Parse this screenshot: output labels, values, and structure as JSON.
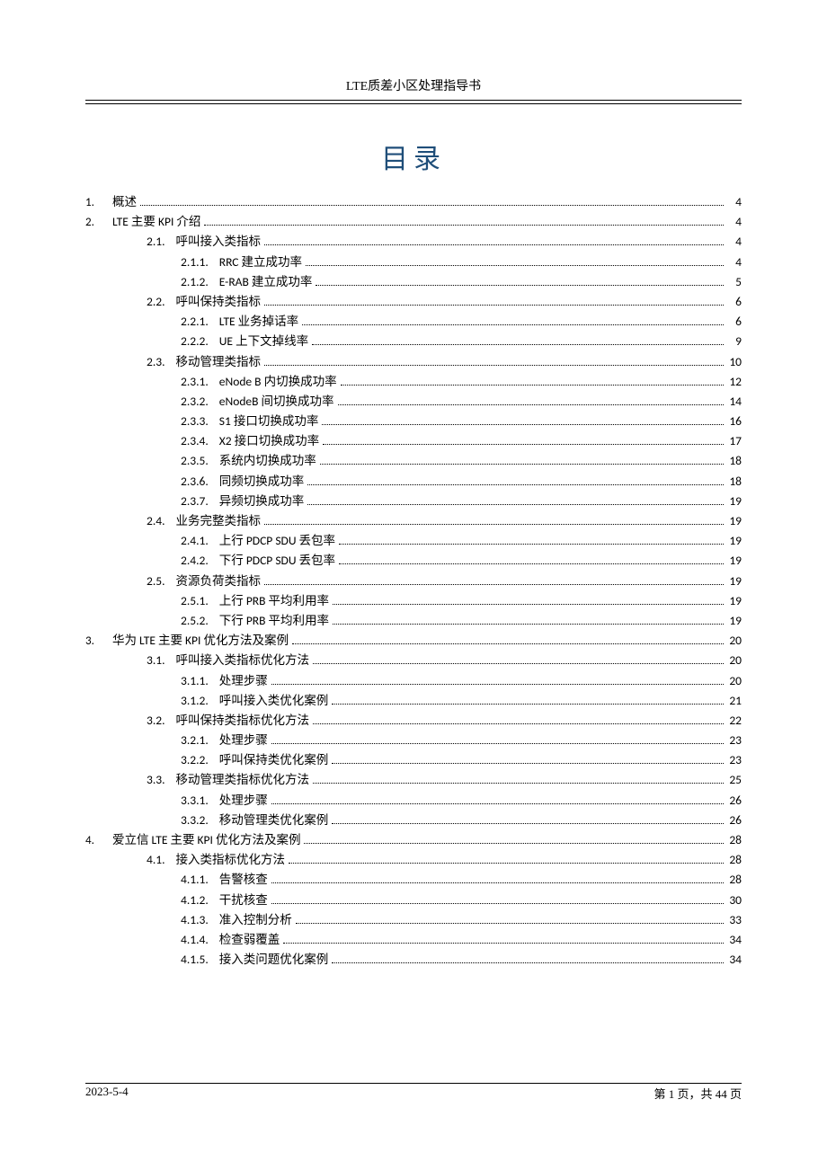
{
  "header": {
    "title": "LTE质差小区处理指导书"
  },
  "toc_title": "目录",
  "entries": [
    {
      "lv": 1,
      "chap": "1.",
      "num": "",
      "text": "概述",
      "page": "4"
    },
    {
      "lv": 1,
      "chap": "2.",
      "num": "",
      "text": "LTE 主要 KPI 介绍",
      "page": "4"
    },
    {
      "lv": 2,
      "chap": "",
      "num": "2.1.",
      "text": "呼叫接入类指标",
      "page": "4"
    },
    {
      "lv": 3,
      "chap": "",
      "num": "2.1.1.",
      "text": "RRC 建立成功率",
      "page": "4"
    },
    {
      "lv": 3,
      "chap": "",
      "num": "2.1.2.",
      "text": "E-RAB 建立成功率",
      "page": "5"
    },
    {
      "lv": 2,
      "chap": "",
      "num": "2.2.",
      "text": "呼叫保持类指标",
      "page": "6"
    },
    {
      "lv": 3,
      "chap": "",
      "num": "2.2.1.",
      "text": "LTE 业务掉话率",
      "page": "6"
    },
    {
      "lv": 3,
      "chap": "",
      "num": "2.2.2.",
      "text": "UE 上下文掉线率",
      "page": "9"
    },
    {
      "lv": 2,
      "chap": "",
      "num": "2.3.",
      "text": "移动管理类指标",
      "page": "10"
    },
    {
      "lv": 3,
      "chap": "",
      "num": "2.3.1.",
      "text": "eNode B 内切换成功率",
      "page": "12"
    },
    {
      "lv": 3,
      "chap": "",
      "num": "2.3.2.",
      "text": "eNodeB 间切换成功率",
      "page": "14"
    },
    {
      "lv": 3,
      "chap": "",
      "num": "2.3.3.",
      "text": "S1 接口切换成功率",
      "page": "16"
    },
    {
      "lv": 3,
      "chap": "",
      "num": "2.3.4.",
      "text": "X2 接口切换成功率",
      "page": "17"
    },
    {
      "lv": 3,
      "chap": "",
      "num": "2.3.5.",
      "text": "系统内切换成功率",
      "page": "18"
    },
    {
      "lv": 3,
      "chap": "",
      "num": "2.3.6.",
      "text": "同频切换成功率",
      "page": "18"
    },
    {
      "lv": 3,
      "chap": "",
      "num": "2.3.7.",
      "text": "异频切换成功率",
      "page": "19"
    },
    {
      "lv": 2,
      "chap": "",
      "num": "2.4.",
      "text": "业务完整类指标",
      "page": "19"
    },
    {
      "lv": 3,
      "chap": "",
      "num": "2.4.1.",
      "text": "上行 PDCP   SDU 丢包率",
      "page": "19"
    },
    {
      "lv": 3,
      "chap": "",
      "num": "2.4.2.",
      "text": "下行 PDCP   SDU 丢包率",
      "page": "19"
    },
    {
      "lv": 2,
      "chap": "",
      "num": "2.5.",
      "text": "资源负荷类指标",
      "page": "19"
    },
    {
      "lv": 3,
      "chap": "",
      "num": "2.5.1.",
      "text": "上行 PRB 平均利用率",
      "page": "19"
    },
    {
      "lv": 3,
      "chap": "",
      "num": "2.5.2.",
      "text": "下行 PRB 平均利用率",
      "page": "19"
    },
    {
      "lv": 1,
      "chap": "3.",
      "num": "",
      "text": "华为 LTE 主要 KPI 优化方法及案例",
      "page": "20"
    },
    {
      "lv": 2,
      "chap": "",
      "num": "3.1.",
      "text": "呼叫接入类指标优化方法",
      "page": "20"
    },
    {
      "lv": 3,
      "chap": "",
      "num": "3.1.1.",
      "text": "处理步骤",
      "page": "20"
    },
    {
      "lv": 3,
      "chap": "",
      "num": "3.1.2.",
      "text": "呼叫接入类优化案例",
      "page": "21"
    },
    {
      "lv": 2,
      "chap": "",
      "num": "3.2.",
      "text": "呼叫保持类指标优化方法",
      "page": "22"
    },
    {
      "lv": 3,
      "chap": "",
      "num": "3.2.1.",
      "text": "处理步骤",
      "page": "23"
    },
    {
      "lv": 3,
      "chap": "",
      "num": "3.2.2.",
      "text": "呼叫保持类优化案例",
      "page": "23"
    },
    {
      "lv": 2,
      "chap": "",
      "num": "3.3.",
      "text": "移动管理类指标优化方法",
      "page": "25"
    },
    {
      "lv": 3,
      "chap": "",
      "num": "3.3.1.",
      "text": "处理步骤",
      "page": "26"
    },
    {
      "lv": 3,
      "chap": "",
      "num": "3.3.2.",
      "text": "移动管理类优化案例",
      "page": "26"
    },
    {
      "lv": 1,
      "chap": "4.",
      "num": "",
      "text": "爱立信 LTE 主要 KPI 优化方法及案例",
      "page": "28"
    },
    {
      "lv": 2,
      "chap": "",
      "num": "4.1.",
      "text": "接入类指标优化方法",
      "page": "28"
    },
    {
      "lv": 3,
      "chap": "",
      "num": "4.1.1.",
      "text": "告警核查",
      "page": "28"
    },
    {
      "lv": 3,
      "chap": "",
      "num": "4.1.2.",
      "text": "干扰核查",
      "page": "30"
    },
    {
      "lv": 3,
      "chap": "",
      "num": "4.1.3.",
      "text": "准入控制分析",
      "page": "33"
    },
    {
      "lv": 3,
      "chap": "",
      "num": "4.1.4.",
      "text": "检查弱覆盖",
      "page": "34"
    },
    {
      "lv": 3,
      "chap": "",
      "num": "4.1.5.",
      "text": "接入类问题优化案例",
      "page": "34"
    }
  ],
  "footer": {
    "date": "2023-5-4",
    "page_label": "第 1 页，共 44 页"
  }
}
